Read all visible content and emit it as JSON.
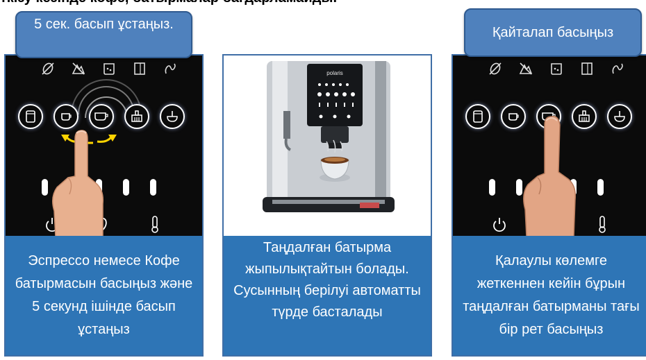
{
  "top_title": "ткізу кезінде кофе, батырмалар бағдарламайды.",
  "left_panel": {
    "callout": "5 сек. басып ұстаңыз.",
    "caption": "Эспрессо немесе Кофе батырмасын басыңыз және 5 секунд ішінде басып ұстаңыз"
  },
  "middle_panel": {
    "brand": "polaris",
    "caption": "Таңдалған батырма жыпылықтайтын болады. Сусынның берілуі автоматты түрде басталады"
  },
  "right_panel": {
    "callout": "Қайталап басыңыз",
    "caption": "Қалаулы көлемге жеткеннен кейін бұрын таңдалған батырманы тағы бір рет басыңыз"
  },
  "colors": {
    "caption_bg": "#2e75b6",
    "callout_bg": "#4f81bd",
    "panel_border": "#3f6ea6",
    "arrow": "#ffd400"
  },
  "icons": {
    "top_row": [
      "no-beans-icon",
      "descale-icon",
      "grounds-icon",
      "water-tank-icon",
      "steam-icon"
    ],
    "buttons": [
      "mug-icon",
      "espresso-cup-icon",
      "coffee-cup-icon",
      "cleaning-icon",
      "hot-water-icon"
    ],
    "bottom_row": [
      "power-icon",
      "bean-icon",
      "temperature-icon"
    ]
  }
}
